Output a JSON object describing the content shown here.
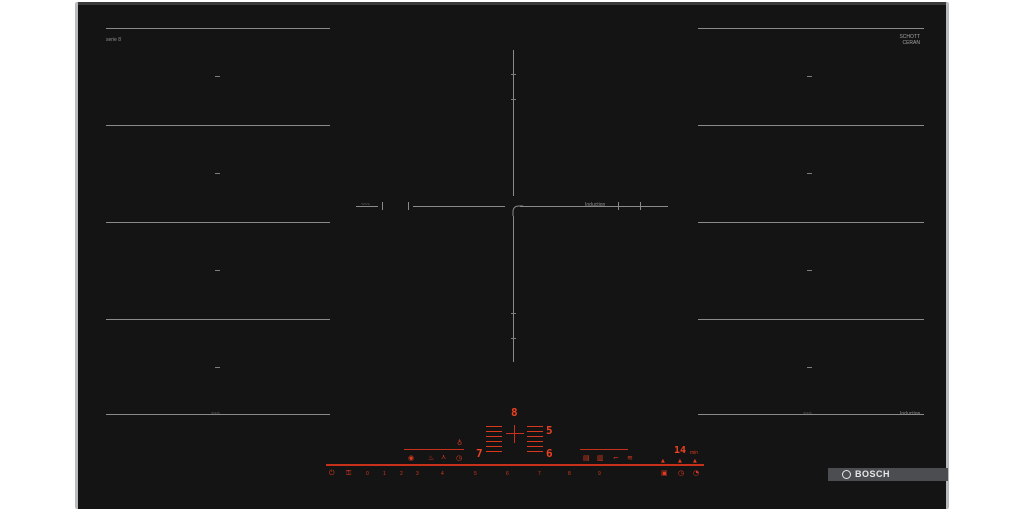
{
  "brand": {
    "name": "BOSCH",
    "glass_maker": "SCHOTT\nCERAN",
    "model_code": "serie 8",
    "glass_code": "B"
  },
  "zones": {
    "left_label": "~~~",
    "center_left_label": "~~~",
    "center_right_label": "Induction",
    "bottom_right_left_label": "~~~",
    "bottom_right_right_label": "Induction"
  },
  "controls": {
    "power_icon": "power-icon",
    "child_lock_icon": "lock-icon",
    "scale_numbers": [
      "0",
      "1",
      "2",
      "3",
      "4",
      "5",
      "6",
      "7",
      "8",
      "9"
    ],
    "power_level_top": "8",
    "power_level_middle": "5",
    "power_level_left": "7",
    "power_level_right": "6",
    "timer_display": "14",
    "timer_unit": "min"
  },
  "colors": {
    "glass": "#141414",
    "display_red": "#e0391f",
    "trim": "#b9bcbf"
  }
}
